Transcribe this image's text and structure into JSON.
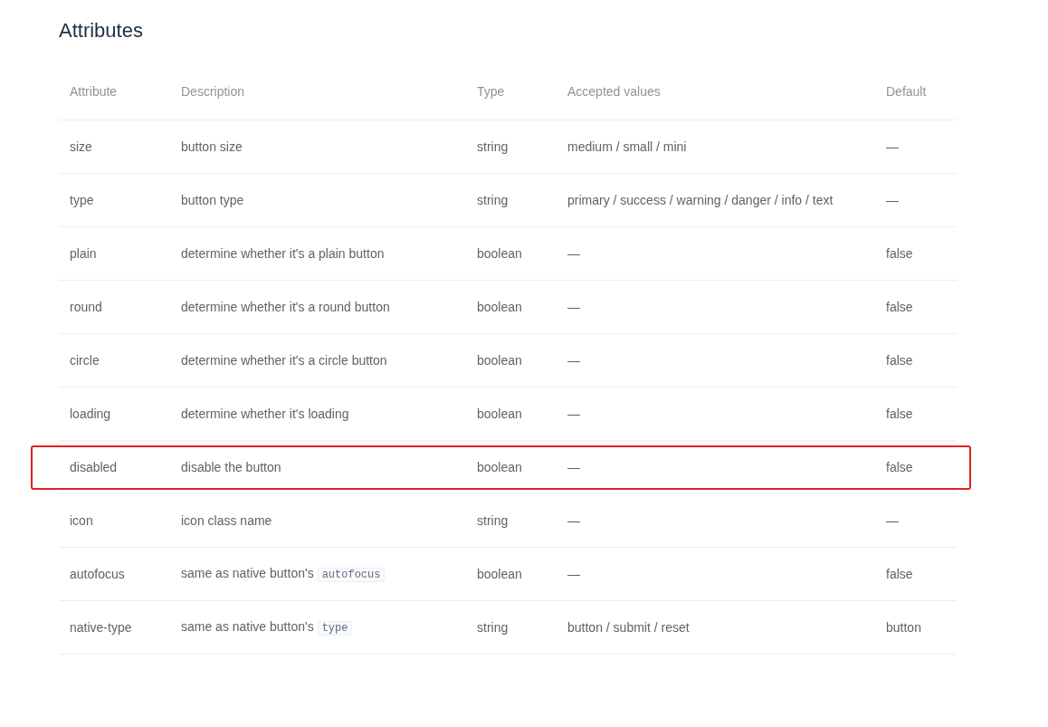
{
  "title": "Attributes",
  "table": {
    "columns": [
      "Attribute",
      "Description",
      "Type",
      "Accepted values",
      "Default"
    ],
    "rows": [
      {
        "attribute": "size",
        "description": "button size",
        "type": "string",
        "accepted_values": "medium / small / mini",
        "default": "—",
        "highlighted": false
      },
      {
        "attribute": "type",
        "description": "button type",
        "type": "string",
        "accepted_values": "primary / success / warning / danger / info / text",
        "default": "—",
        "highlighted": false
      },
      {
        "attribute": "plain",
        "description": "determine whether it's a plain button",
        "type": "boolean",
        "accepted_values": "—",
        "default": "false",
        "highlighted": false
      },
      {
        "attribute": "round",
        "description": "determine whether it's a round button",
        "type": "boolean",
        "accepted_values": "—",
        "default": "false",
        "highlighted": false
      },
      {
        "attribute": "circle",
        "description": "determine whether it's a circle button",
        "type": "boolean",
        "accepted_values": "—",
        "default": "false",
        "highlighted": false
      },
      {
        "attribute": "loading",
        "description": "determine whether it's loading",
        "type": "boolean",
        "accepted_values": "—",
        "default": "false",
        "highlighted": false
      },
      {
        "attribute": "disabled",
        "description": "disable the button",
        "type": "boolean",
        "accepted_values": "—",
        "default": "false",
        "highlighted": true
      },
      {
        "attribute": "icon",
        "description": "icon class name",
        "type": "string",
        "accepted_values": "—",
        "default": "—",
        "highlighted": false
      },
      {
        "attribute": "autofocus",
        "description": "same as native button's",
        "code": "autofocus",
        "type": "boolean",
        "accepted_values": "—",
        "default": "false",
        "highlighted": false
      },
      {
        "attribute": "native-type",
        "description": "same as native button's",
        "code": "type",
        "type": "string",
        "accepted_values": "button / submit / reset",
        "default": "button",
        "highlighted": false
      }
    ]
  }
}
